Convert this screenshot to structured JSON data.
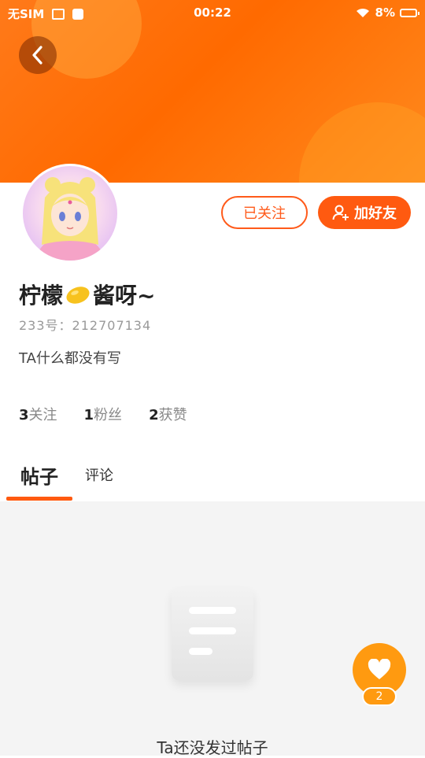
{
  "status_bar": {
    "sim": "无SIM",
    "time": "00:22",
    "battery": "8%"
  },
  "profile": {
    "name_part1": "柠檬",
    "name_part2": "酱呀~",
    "uid": "233号：212707134",
    "bio": "TA什么都没有写"
  },
  "actions": {
    "follow_label": "已关注",
    "add_friend_label": "加好友"
  },
  "stats": [
    {
      "value": "3",
      "label": "关注"
    },
    {
      "value": "1",
      "label": "粉丝"
    },
    {
      "value": "2",
      "label": "获赞"
    }
  ],
  "tabs": {
    "posts": "帖子",
    "comments": "评论"
  },
  "empty_state": {
    "text": "Ta还没发过帖子"
  },
  "like_fab": {
    "count": "2"
  },
  "colors": {
    "accent": "#ff5a10",
    "header": "#ff7a1a",
    "fab": "#ff9a10"
  }
}
